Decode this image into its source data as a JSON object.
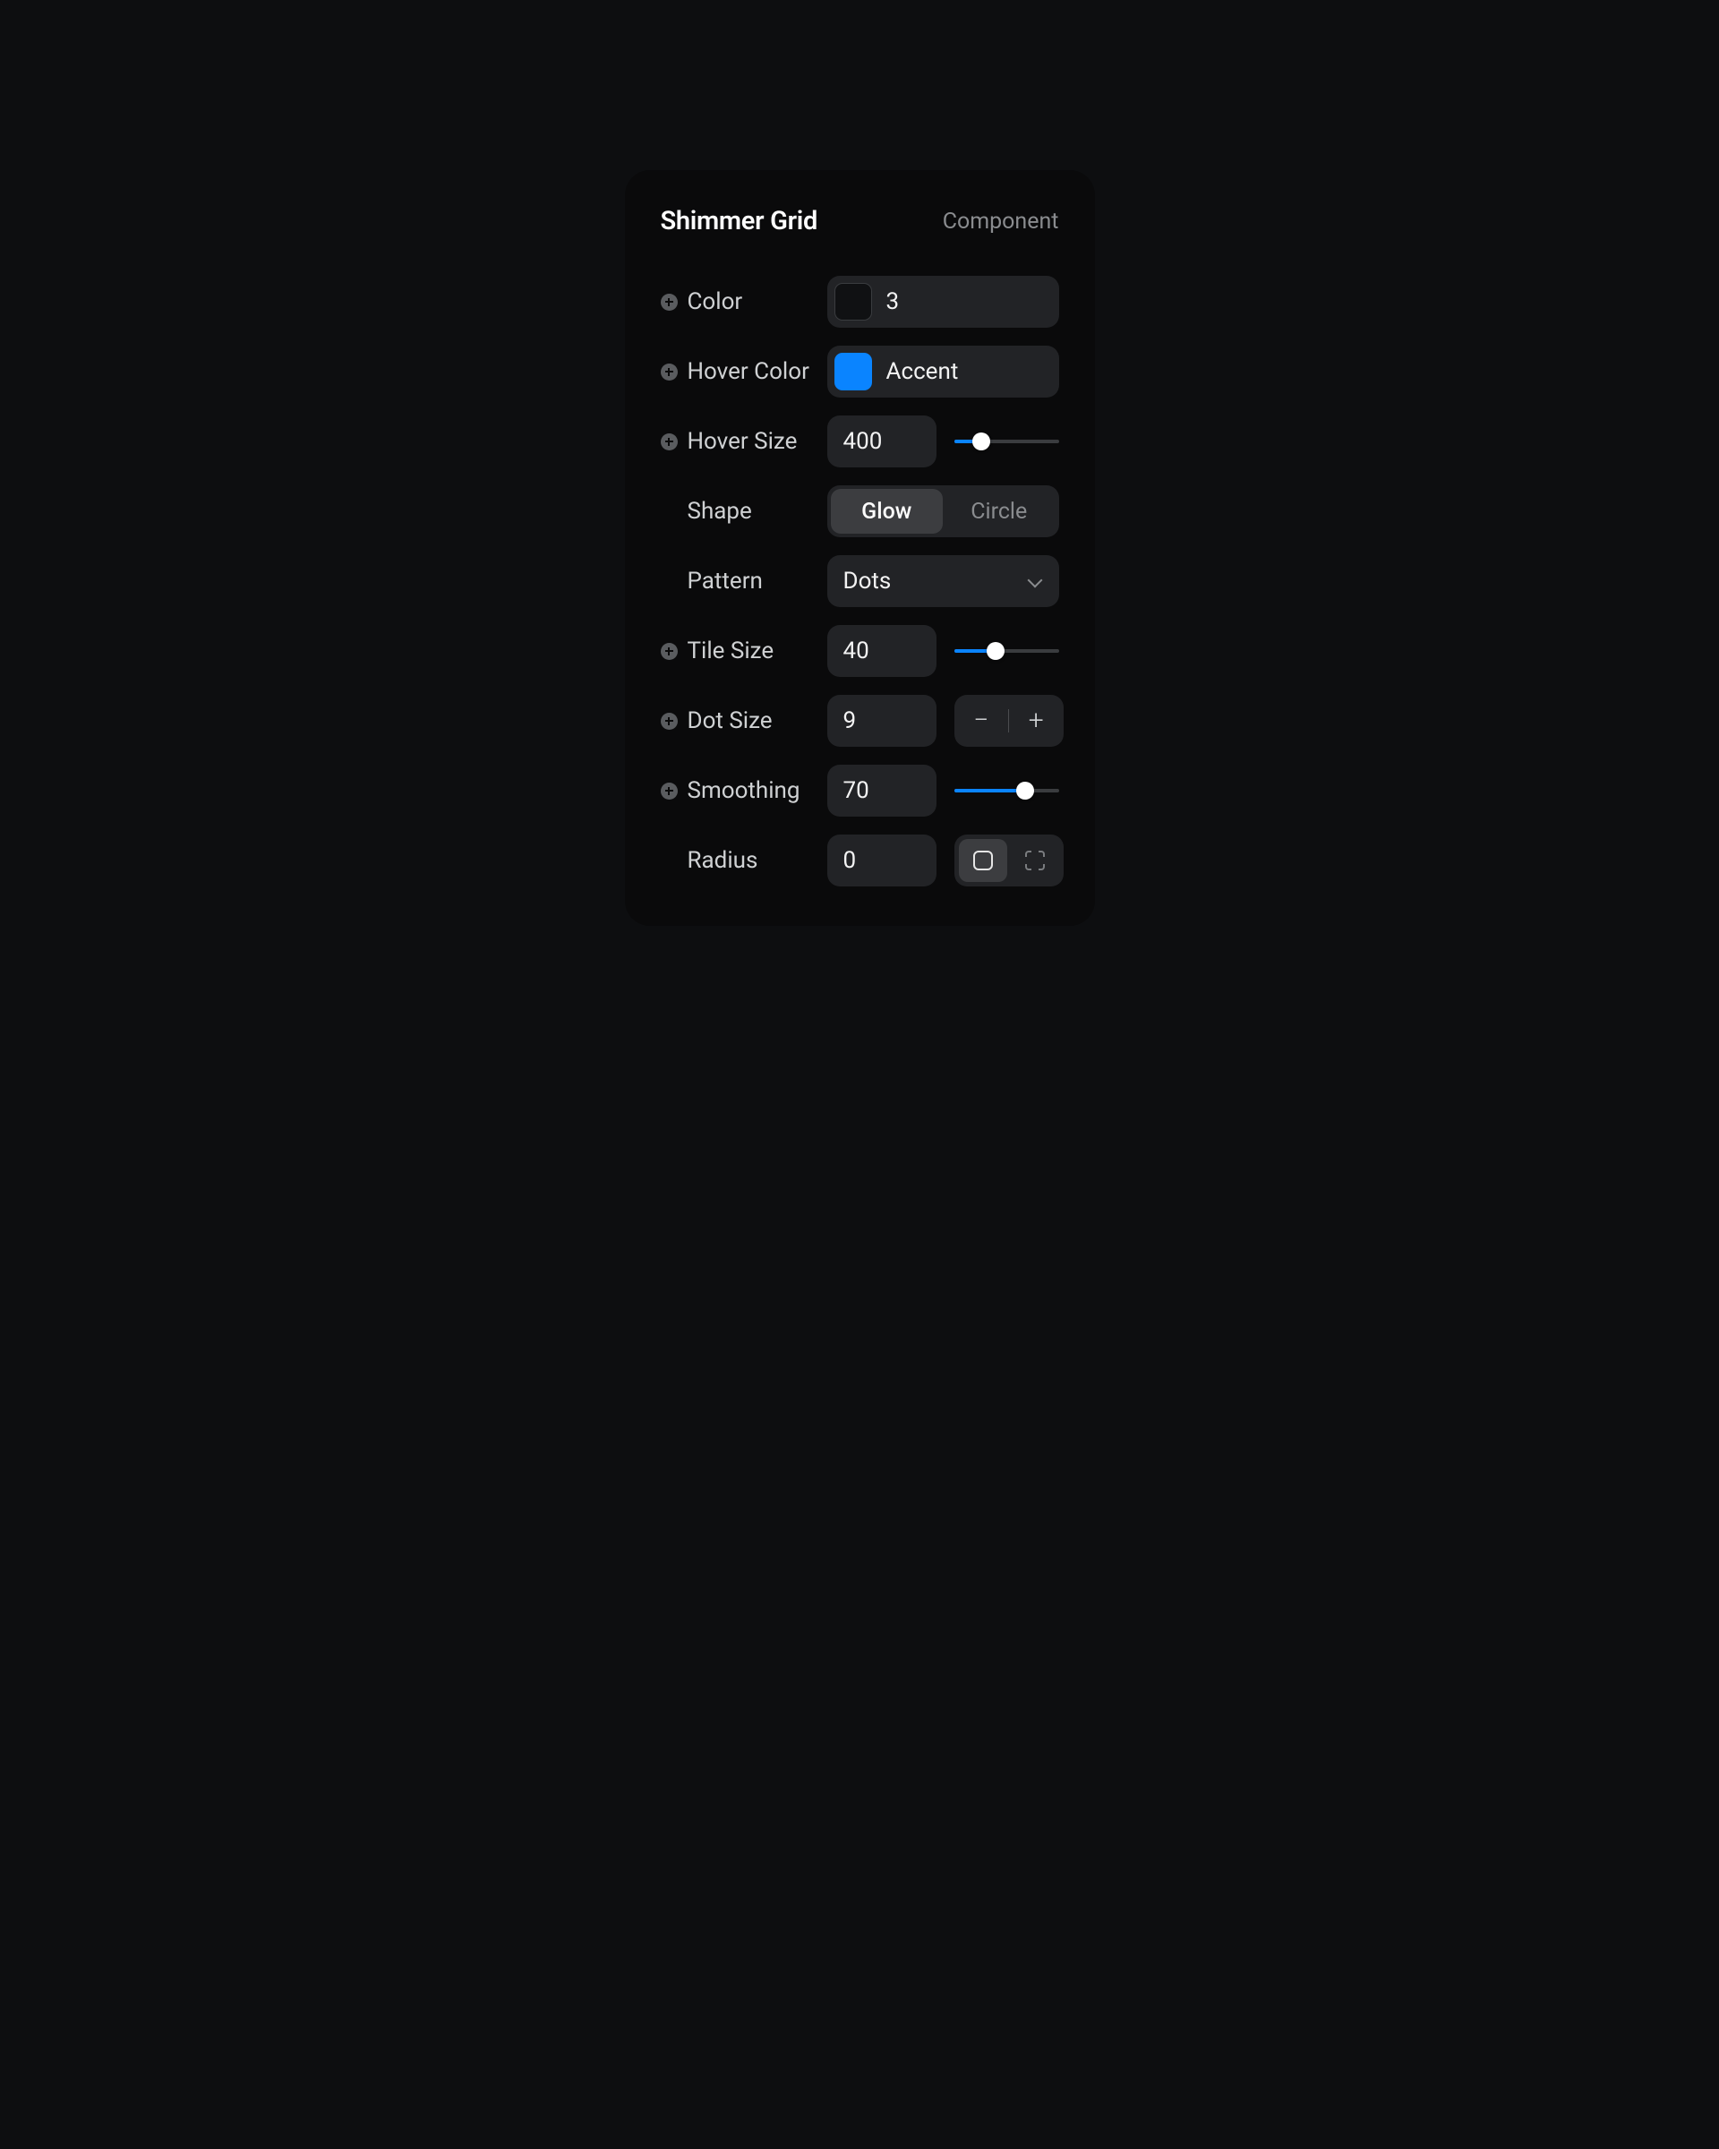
{
  "header": {
    "title": "Shimmer Grid",
    "tag": "Component"
  },
  "props": {
    "color": {
      "label": "Color",
      "value": "3",
      "swatch": "#101113"
    },
    "hoverColor": {
      "label": "Hover Color",
      "value": "Accent",
      "swatch": "#0a84ff"
    },
    "hoverSize": {
      "label": "Hover Size",
      "value": "400",
      "sliderPercent": 26
    },
    "shape": {
      "label": "Shape",
      "options": [
        "Glow",
        "Circle"
      ],
      "selected": "Glow"
    },
    "pattern": {
      "label": "Pattern",
      "value": "Dots"
    },
    "tileSize": {
      "label": "Tile Size",
      "value": "40",
      "sliderPercent": 40
    },
    "dotSize": {
      "label": "Dot Size",
      "value": "9"
    },
    "smoothing": {
      "label": "Smoothing",
      "value": "70",
      "sliderPercent": 68
    },
    "radius": {
      "label": "Radius",
      "value": "0",
      "selected": "square"
    }
  }
}
